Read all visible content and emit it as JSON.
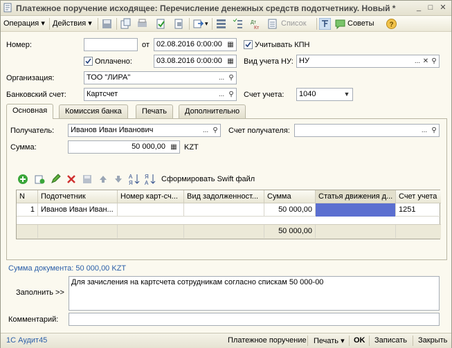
{
  "window": {
    "title": "Платежное поручение исходящее: Перечисление денежных средств подотчетнику. Новый *"
  },
  "toolbar": {
    "operation": "Операция",
    "actions": "Действия",
    "list": "Список",
    "tips": "Советы"
  },
  "header": {
    "number_label": "Номер:",
    "number_value": "",
    "from_label": "от",
    "date_value": "02.08.2016  0:00:00",
    "kpn_label": "Учитывать КПН",
    "paid_label": "Оплачено:",
    "paid_date_value": "03.08.2016  0:00:00",
    "nu_type_label": "Вид учета НУ:",
    "nu_type_value": "НУ",
    "org_label": "Организация:",
    "org_value": "ТОО \"ЛИРА\"",
    "bank_account_label": "Банковский счет:",
    "bank_account_value": "Картсчет",
    "account_label": "Счет учета:",
    "account_value": "1040"
  },
  "tabs": [
    {
      "label": "Основная"
    },
    {
      "label": "Комиссия банка"
    },
    {
      "label": "Печать"
    },
    {
      "label": "Дополнительно"
    }
  ],
  "main": {
    "recipient_label": "Получатель:",
    "recipient_value": "Иванов Иван Иванович",
    "recipient_account_label": "Счет получателя:",
    "recipient_account_value": "",
    "amount_label": "Сумма:",
    "amount_value": "50 000,00",
    "currency": "KZT",
    "swift_button": "Сформировать Swift файл"
  },
  "table": {
    "columns": [
      "N",
      "Подотчетник",
      "Номер карт-сч...",
      "Вид задолженност...",
      "Сумма",
      "Статья движения д...",
      "Счет учета"
    ],
    "rows": [
      {
        "n": "1",
        "person": "Иванов Иван Иван...",
        "card": "",
        "debt_type": "",
        "sum": "50 000,00",
        "article": "",
        "account": "1251"
      }
    ],
    "total_sum": "50 000,00"
  },
  "footer": {
    "doc_sum": "Сумма документа: 50 000,00 KZT",
    "fill_label": "Заполнить >>",
    "fill_text": "Для зачисления на картсчета сотрудникам согласно спискам 50 000-00",
    "comment_label": "Комментарий:",
    "comment_value": ""
  },
  "statusbar": {
    "app": "1С Аудит45",
    "payment_order": "Платежное поручение",
    "print": "Печать",
    "ok": "OK",
    "save": "Записать",
    "close": "Закрыть"
  },
  "colors": {
    "selected_cell": "#5b6fd0",
    "link_blue": "#2a5ea8"
  }
}
